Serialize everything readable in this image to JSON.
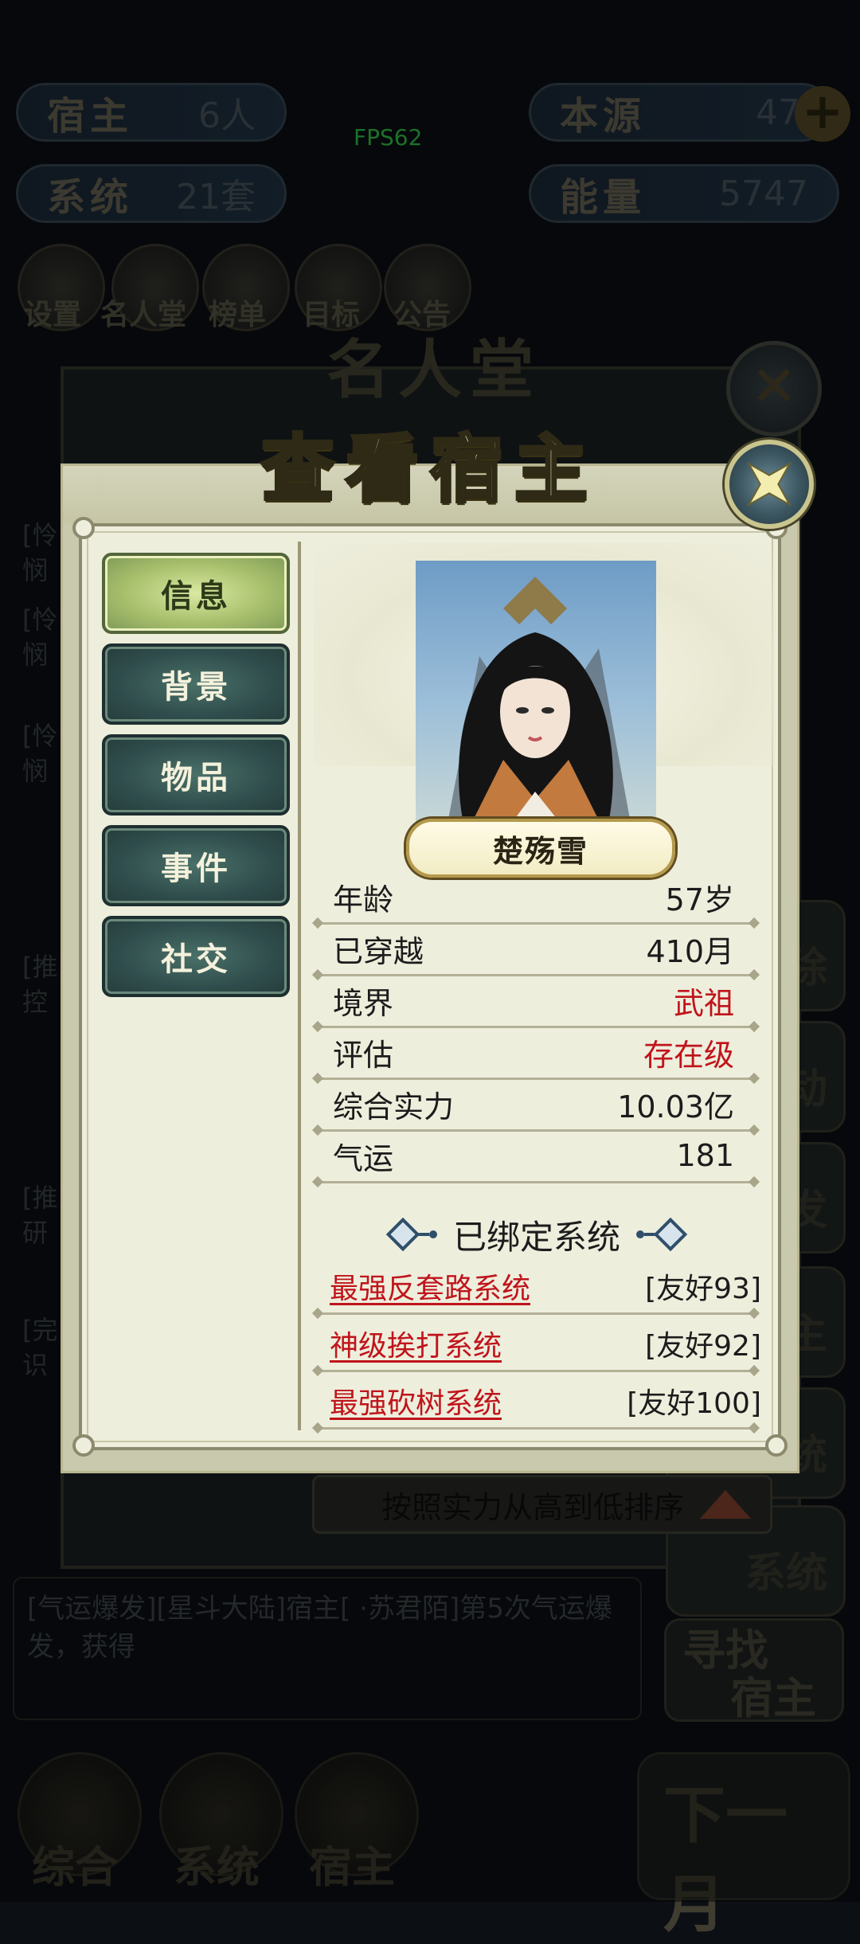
{
  "hud": {
    "host_label": "宿主",
    "host_value": "6人",
    "source_label": "本源",
    "source_value": "47",
    "system_label": "系统",
    "system_value": "21套",
    "energy_label": "能量",
    "energy_value": "5747",
    "fps": "FPS62",
    "top_icons": [
      "设置",
      "名人堂",
      "榜单",
      "目标",
      "公告"
    ]
  },
  "background": {
    "panel_title": "名人堂",
    "side_buttons": [
      "除",
      "动",
      "发",
      "主",
      "统",
      "系统"
    ],
    "left_snippets": [
      "[怜",
      "悯",
      "[怜",
      "悯",
      "[怜",
      "悯",
      "[推",
      "控",
      "[推",
      "研",
      "[完",
      "识"
    ],
    "log_text": "[气运爆发][星斗大陆]宿主[        ·苏君陌]第5次气运爆发，获得",
    "find_host": [
      "寻找",
      "宿主"
    ],
    "sort_label": "按照实力从高到低排序",
    "bottom_nav": [
      "综合",
      "系统",
      "宿主"
    ],
    "next_month": "下一月"
  },
  "dialog": {
    "title": "查看宿主",
    "tabs": [
      "信息",
      "背景",
      "物品",
      "事件",
      "社交"
    ],
    "active_tab": 0,
    "host_name": "楚殇雪",
    "info": [
      {
        "label": "年龄",
        "value": "57岁",
        "red": false
      },
      {
        "label": "已穿越",
        "value": "410月",
        "red": false
      },
      {
        "label": "境界",
        "value": "武祖",
        "red": true
      },
      {
        "label": "评估",
        "value": "存在级",
        "red": true
      },
      {
        "label": "综合实力",
        "value": "10.03亿",
        "red": false
      },
      {
        "label": "气运",
        "value": "181",
        "red": false
      }
    ],
    "bound_systems_title": "已绑定系统",
    "systems": [
      {
        "name": "最强反套路系统",
        "favor": "[友好93]"
      },
      {
        "name": "神级挨打系统",
        "favor": "[友好92]"
      },
      {
        "name": "最强砍树系统",
        "favor": "[友好100]"
      }
    ]
  },
  "colors": {
    "red_value": "#c0141b",
    "tab_active": "#a8c06c",
    "tab_inactive": "#2f4d4c",
    "panel_bg": "#eeeedd"
  }
}
